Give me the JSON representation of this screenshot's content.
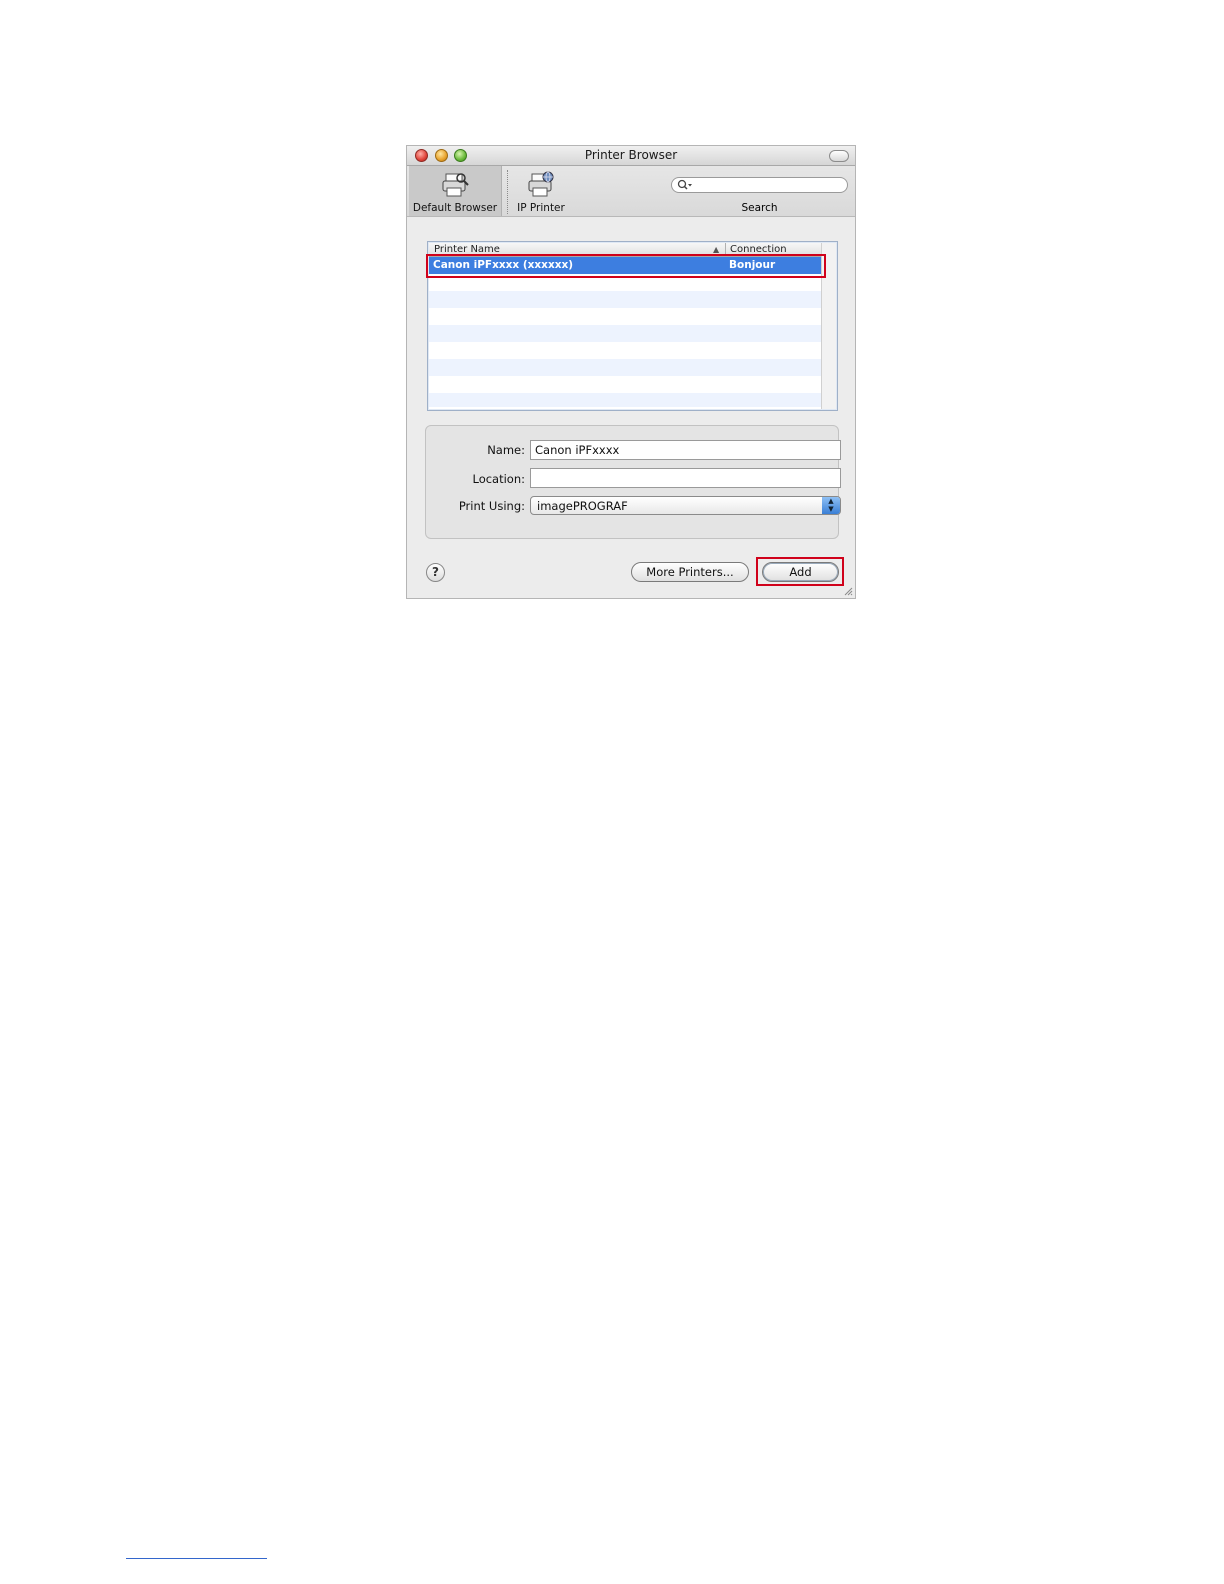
{
  "window": {
    "title": "Printer Browser"
  },
  "toolbar": {
    "default_browser_label": "Default Browser",
    "ip_printer_label": "IP Printer",
    "search_label": "Search",
    "search_value": ""
  },
  "printer_list": {
    "columns": [
      "Printer Name",
      "Connection"
    ],
    "sort_indicator": "▲",
    "rows": [
      {
        "name": "Canon iPFxxxx (xxxxxx)",
        "connection": "Bonjour",
        "selected": true
      }
    ]
  },
  "form": {
    "name_label": "Name:",
    "name_value": "Canon iPFxxxx",
    "location_label": "Location:",
    "location_value": "",
    "print_using_label": "Print Using:",
    "print_using_value": "imagePROGRAF"
  },
  "buttons": {
    "help": "?",
    "more_printers": "More Printers...",
    "add": "Add"
  },
  "colors": {
    "selection": "#3d7ee0",
    "highlight_box": "#d0021b"
  }
}
